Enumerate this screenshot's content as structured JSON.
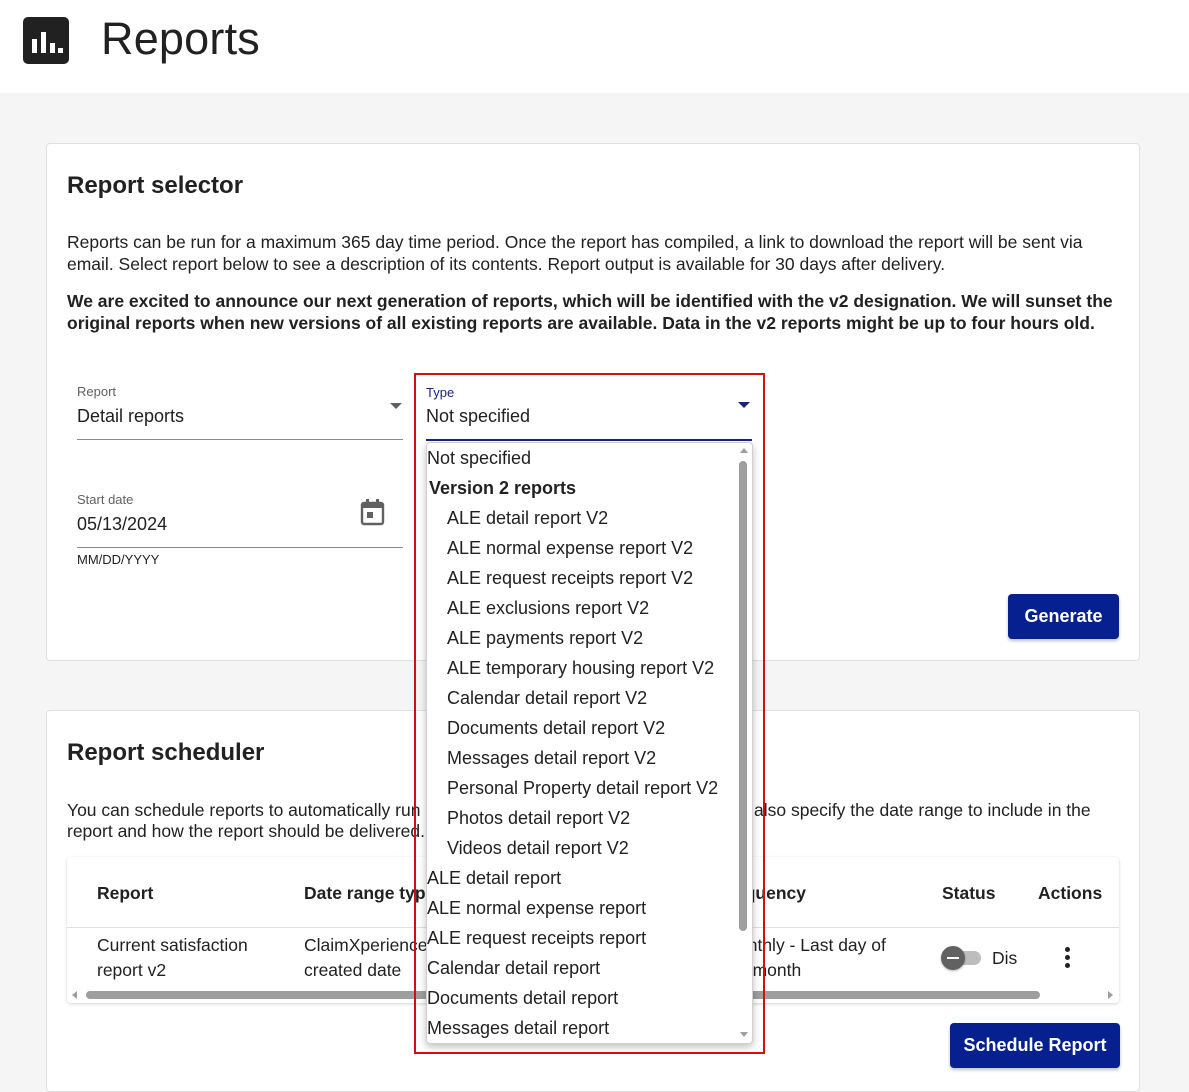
{
  "header": {
    "title": "Reports",
    "logo_icon": "bar-chart-icon"
  },
  "report_selector": {
    "title": "Report selector",
    "description": "Reports can be run for a maximum 365 day time period. Once the report has compiled, a link to download the report will be sent via email. Select report below to see a description of its contents. Report output is available for 30 days after delivery.",
    "announcement": "We are excited to announce our next generation of reports, which will be identified with the v2 designation. We will sunset the original reports when new versions of all existing reports are available. Data in the v2 reports might be up to four hours old.",
    "report_field": {
      "label": "Report",
      "value": "Detail reports"
    },
    "type_field": {
      "label": "Type",
      "value": "Not specified"
    },
    "start_date": {
      "label": "Start date",
      "value": "05/13/2024",
      "helper": "MM/DD/YYYY",
      "icon": "calendar-icon"
    },
    "generate_label": "Generate"
  },
  "type_dropdown": {
    "options": [
      {
        "label": "Not specified",
        "kind": "option"
      },
      {
        "label": "Version 2 reports",
        "kind": "group"
      },
      {
        "label": "ALE detail report V2",
        "kind": "indent"
      },
      {
        "label": "ALE normal expense report V2",
        "kind": "indent"
      },
      {
        "label": "ALE request receipts report V2",
        "kind": "indent"
      },
      {
        "label": "ALE exclusions report V2",
        "kind": "indent"
      },
      {
        "label": "ALE payments report V2",
        "kind": "indent"
      },
      {
        "label": "ALE temporary housing report V2",
        "kind": "indent"
      },
      {
        "label": "Calendar detail report V2",
        "kind": "indent"
      },
      {
        "label": "Documents detail report V2",
        "kind": "indent"
      },
      {
        "label": "Messages detail report V2",
        "kind": "indent"
      },
      {
        "label": "Personal Property detail report V2",
        "kind": "indent"
      },
      {
        "label": "Photos detail report V2",
        "kind": "indent"
      },
      {
        "label": "Videos detail report V2",
        "kind": "indent"
      },
      {
        "label": "ALE detail report",
        "kind": "option"
      },
      {
        "label": "ALE normal expense report",
        "kind": "option"
      },
      {
        "label": "ALE request receipts report",
        "kind": "option"
      },
      {
        "label": "Calendar detail report",
        "kind": "option"
      },
      {
        "label": "Documents detail report",
        "kind": "option"
      },
      {
        "label": "Messages detail report",
        "kind": "option"
      }
    ]
  },
  "report_scheduler": {
    "title": "Report scheduler",
    "description_left_1": "You can schedule reports to automatically run",
    "description_left_2": "report and how the report should be delivered.",
    "description_right_1": "also specify the date range to include in the",
    "columns": {
      "report": "Report",
      "date_range": "Date range type",
      "frequency": "equency",
      "status": "Status",
      "actions": "Actions"
    },
    "row": {
      "report_1": "Current satisfaction",
      "report_2": "report v2",
      "date_range_1": "ClaimXperience",
      "date_range_2": "created date",
      "frequency_1": "onthly - Last day of",
      "frequency_2": "e month",
      "status": "Dis"
    },
    "schedule_label": "Schedule Report"
  },
  "colors": {
    "primary": "#06218f",
    "highlight": "#d20f0f",
    "accent_blue": "#1a237e"
  }
}
